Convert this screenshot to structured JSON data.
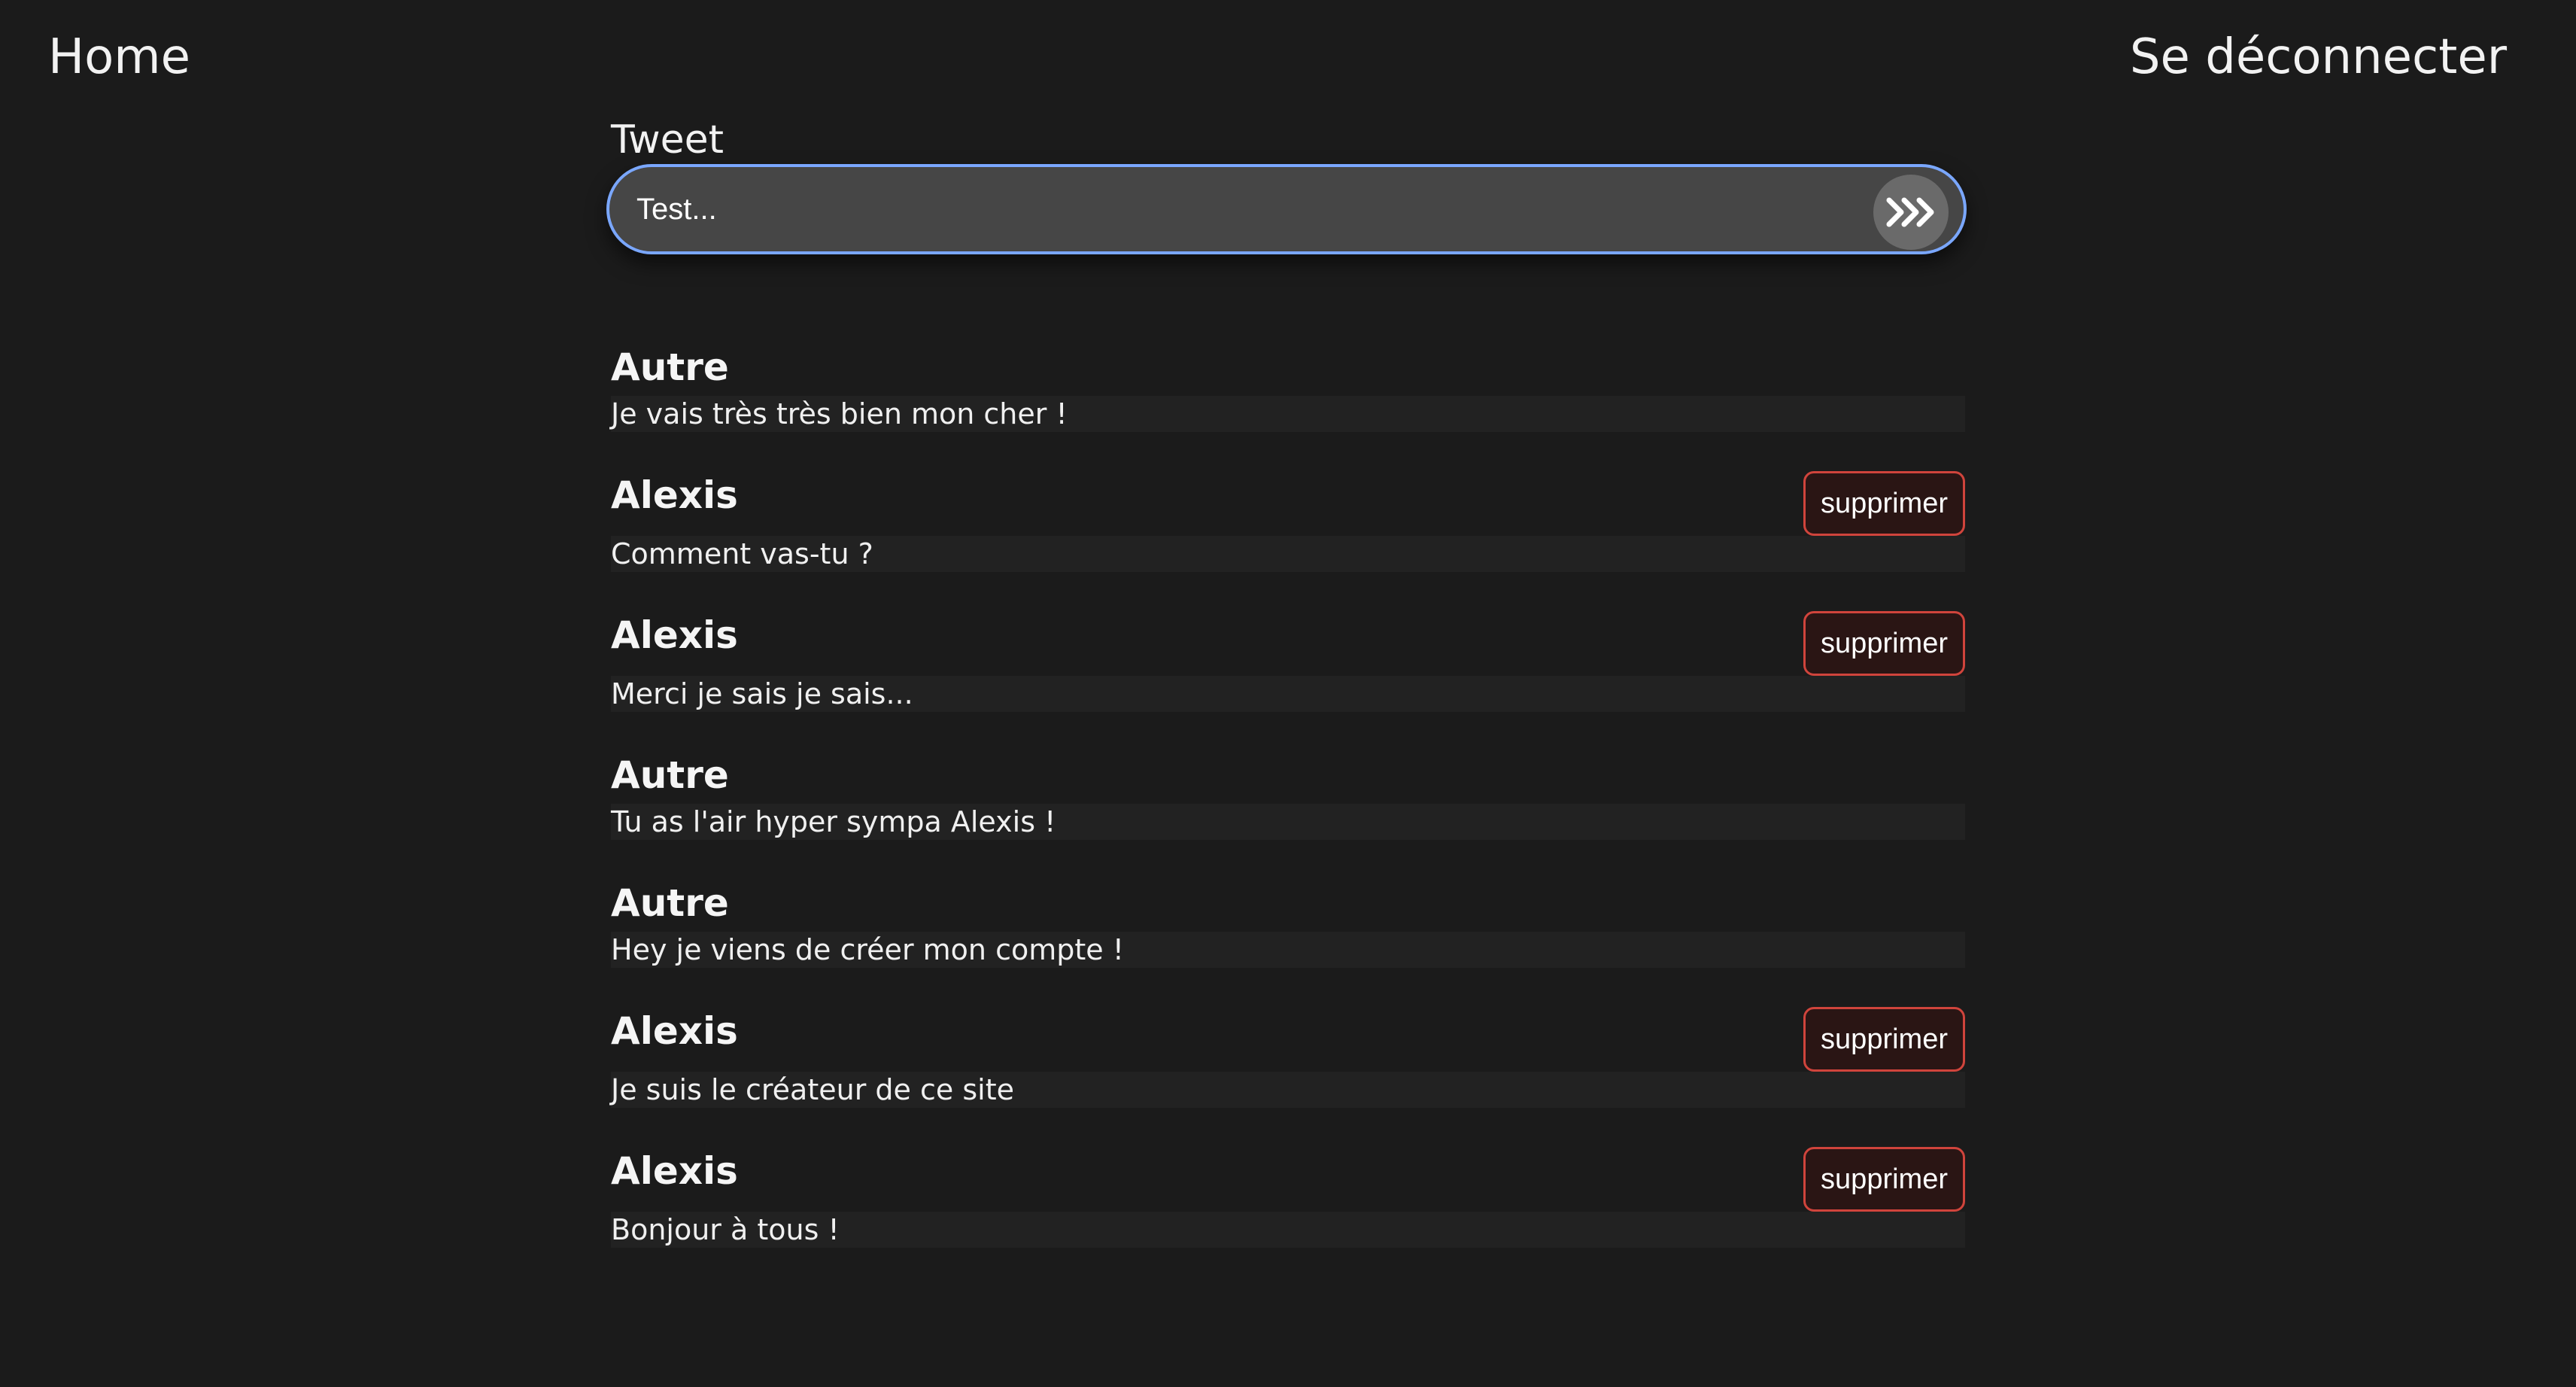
{
  "nav": {
    "home_label": "Home",
    "logout_label": "Se déconnecter"
  },
  "composer": {
    "label": "Tweet",
    "input_value": "Test...",
    "submit_icon": "triple-chevron-right-icon"
  },
  "posts": [
    {
      "author": "Autre",
      "text": "Je vais très très bien mon cher !",
      "delete_label": null
    },
    {
      "author": "Alexis",
      "text": "Comment vas-tu ?",
      "delete_label": "supprimer"
    },
    {
      "author": "Alexis",
      "text": "Merci je sais je sais...",
      "delete_label": "supprimer"
    },
    {
      "author": "Autre",
      "text": "Tu as l'air hyper sympa Alexis !",
      "delete_label": null
    },
    {
      "author": "Autre",
      "text": "Hey je viens de créer mon compte !",
      "delete_label": null
    },
    {
      "author": "Alexis",
      "text": "Je suis le créateur de ce site",
      "delete_label": "supprimer"
    },
    {
      "author": "Alexis",
      "text": "Bonjour à tous !",
      "delete_label": "supprimer"
    }
  ],
  "colors": {
    "background": "#1b1b1b",
    "input_border": "#7aa7ff",
    "delete_border": "#d0443c"
  }
}
